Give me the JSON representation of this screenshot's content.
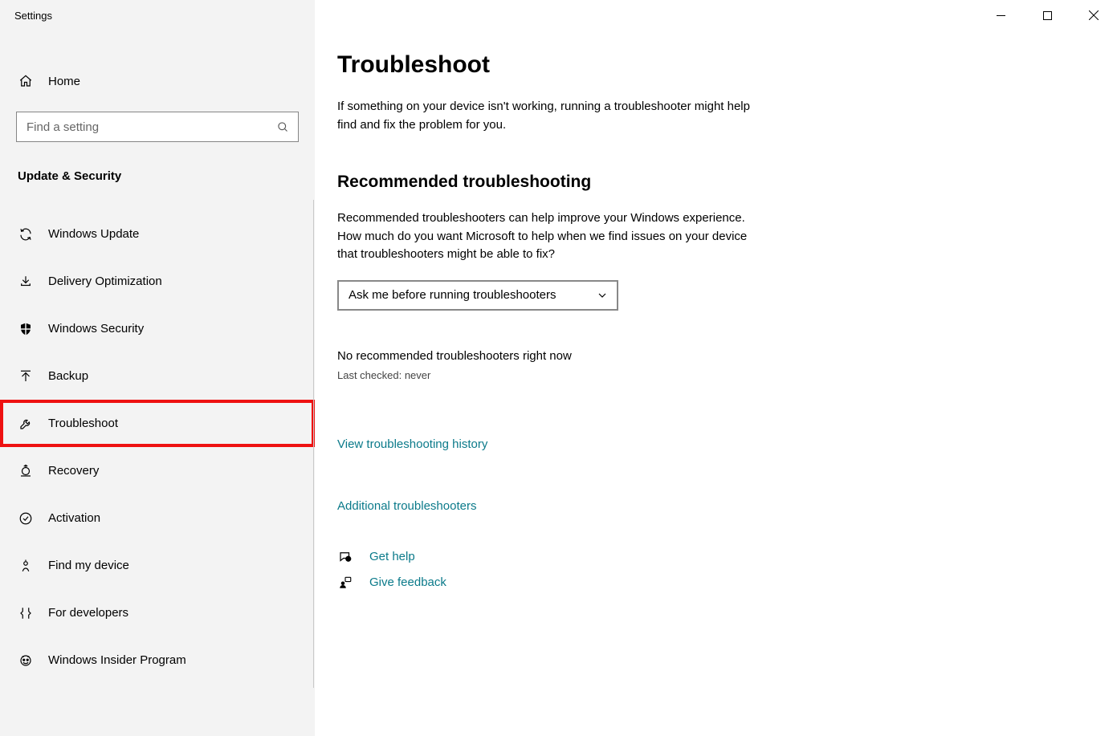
{
  "app": {
    "title": "Settings"
  },
  "sidebar": {
    "home": "Home",
    "search_placeholder": "Find a setting",
    "section": "Update & Security",
    "items": [
      {
        "label": "Windows Update"
      },
      {
        "label": "Delivery Optimization"
      },
      {
        "label": "Windows Security"
      },
      {
        "label": "Backup"
      },
      {
        "label": "Troubleshoot"
      },
      {
        "label": "Recovery"
      },
      {
        "label": "Activation"
      },
      {
        "label": "Find my device"
      },
      {
        "label": "For developers"
      },
      {
        "label": "Windows Insider Program"
      }
    ]
  },
  "main": {
    "title": "Troubleshoot",
    "lead": "If something on your device isn't working, running a troubleshooter might help find and fix the problem for you.",
    "subhead": "Recommended troubleshooting",
    "para": "Recommended troubleshooters can help improve your Windows experience. How much do you want Microsoft to help when we find issues on your device that troubleshooters might be able to fix?",
    "dropdown_value": "Ask me before running troubleshooters",
    "status1": "No recommended troubleshooters right now",
    "status2": "Last checked: never",
    "link_history": "View troubleshooting history",
    "link_additional": "Additional troubleshooters",
    "get_help": "Get help",
    "give_feedback": "Give feedback"
  }
}
